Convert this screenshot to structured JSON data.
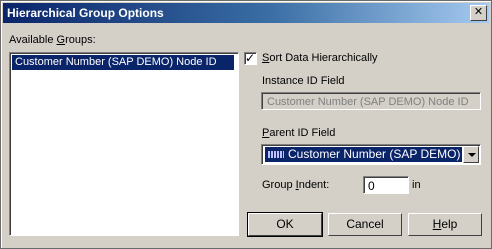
{
  "window": {
    "title": "Hierarchical Group Options",
    "close_glyph": "✕"
  },
  "groups": {
    "label_pre": "Available ",
    "label_key": "G",
    "label_post": "roups:",
    "items": [
      "Customer Number (SAP DEMO) Node ID"
    ]
  },
  "sort": {
    "checked": true,
    "check_glyph": "✓",
    "label_key": "S",
    "label_post": "ort Data Hierarchically"
  },
  "instance": {
    "label": "Instance ID Field",
    "value": "Customer Number (SAP DEMO) Node ID"
  },
  "parent": {
    "label_key": "P",
    "label_post": "arent ID Field",
    "value": "Customer Number (SAP DEMO) Parent",
    "icon": "field-icon"
  },
  "indent": {
    "label_pre": "Group ",
    "label_key": "I",
    "label_post": "ndent:",
    "value": "0",
    "unit": "in"
  },
  "buttons": {
    "ok": "OK",
    "cancel": "Cancel",
    "help_key": "H",
    "help_post": "elp"
  }
}
